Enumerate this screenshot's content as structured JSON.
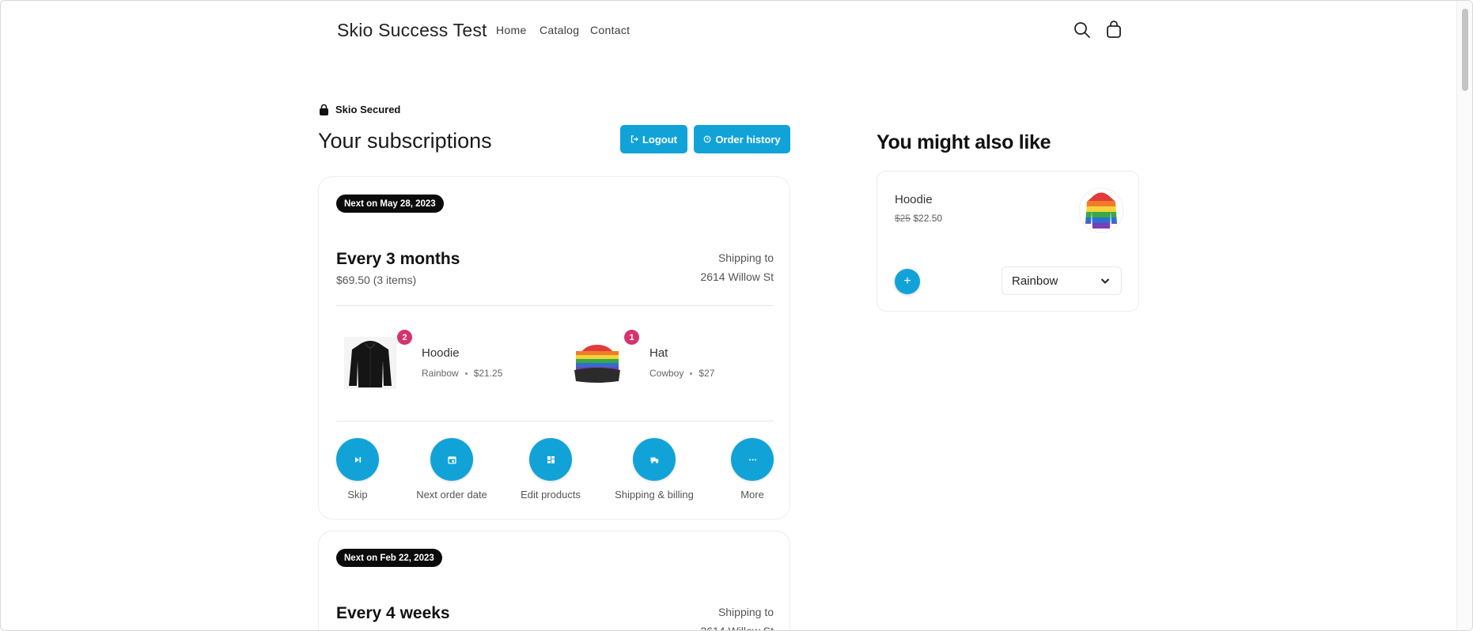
{
  "header": {
    "brand": "Skio Success Test",
    "nav": [
      "Home",
      "Catalog",
      "Contact"
    ]
  },
  "secured_label": "Skio Secured",
  "page_title": "Your subscriptions",
  "buttons": {
    "logout": "Logout",
    "order_history": "Order history"
  },
  "subscriptions": [
    {
      "next_label": "Next on May 28, 2023",
      "frequency": "Every 3 months",
      "summary": "$69.50 (3 items)",
      "shipping_label": "Shipping to",
      "shipping_address": "2614 Willow St",
      "products": [
        {
          "name": "Hoodie",
          "variant": "Rainbow",
          "price": "$21.25",
          "qty": "2"
        },
        {
          "name": "Hat",
          "variant": "Cowboy",
          "price": "$27",
          "qty": "1"
        }
      ],
      "actions": [
        "Skip",
        "Next order date",
        "Edit products",
        "Shipping & billing",
        "More"
      ]
    },
    {
      "next_label": "Next on Feb 22, 2023",
      "frequency": "Every 4 weeks",
      "shipping_label": "Shipping to",
      "shipping_address": "2614 Willow St"
    }
  ],
  "recommendations": {
    "title": "You might also like",
    "items": [
      {
        "name": "Hoodie",
        "original_price": "$25",
        "sale_price": "$22.50",
        "selected_option": "Rainbow",
        "add_label": "+"
      }
    ]
  },
  "colors": {
    "accent": "#11a3d8",
    "badge": "#d6336c",
    "pill": "#0b0b0b"
  }
}
